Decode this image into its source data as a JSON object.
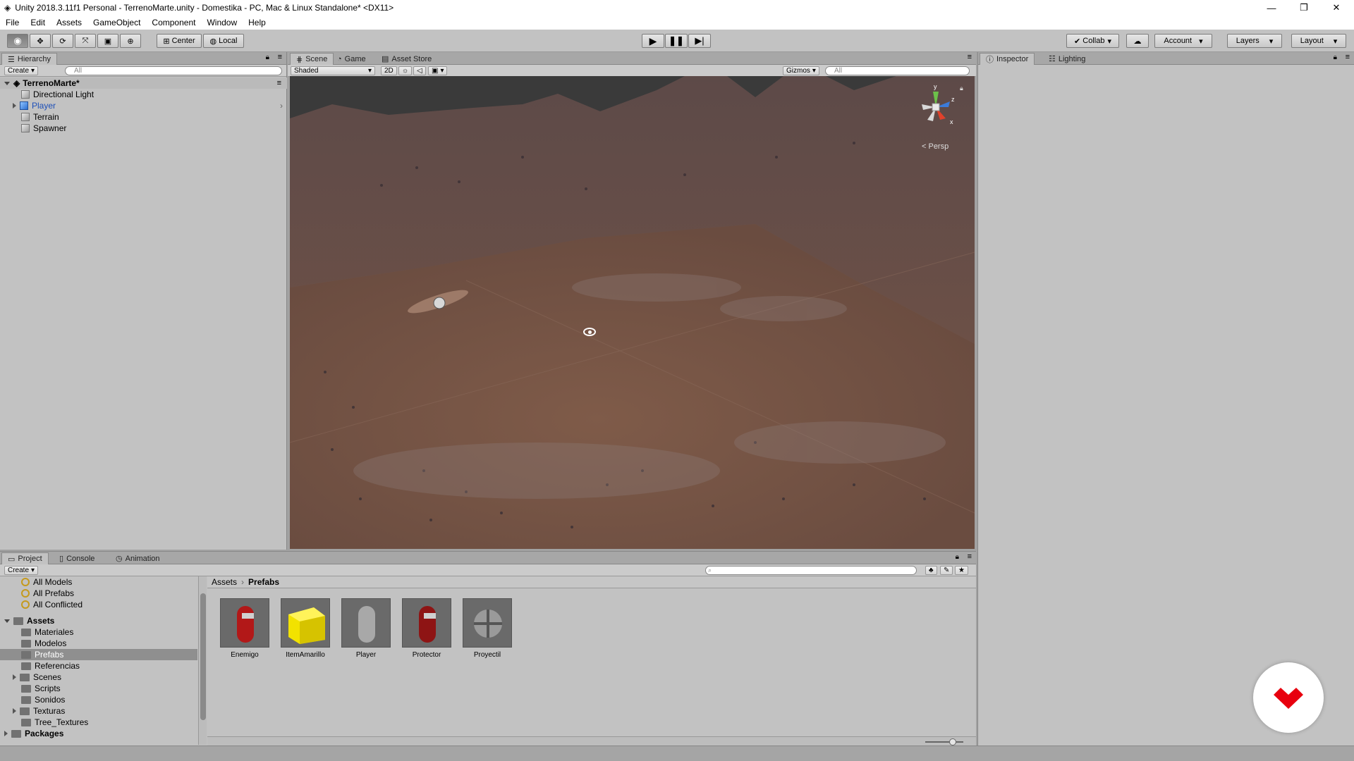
{
  "window": {
    "title": "Unity 2018.3.11f1 Personal - TerrenoMarte.unity - Domestika - PC, Mac & Linux Standalone* <DX11>"
  },
  "menu": [
    "File",
    "Edit",
    "Assets",
    "GameObject",
    "Component",
    "Window",
    "Help"
  ],
  "toolbar": {
    "pivot": "Center",
    "space": "Local",
    "collab": "Collab",
    "account": "Account",
    "layers": "Layers",
    "layout": "Layout"
  },
  "hierarchy": {
    "tab": "Hierarchy",
    "create": "Create",
    "search_placeholder": "All",
    "scene": "TerrenoMarte*",
    "items": [
      "Directional Light",
      "Player",
      "Terrain",
      "Spawner"
    ]
  },
  "scene_tabs": [
    "Scene",
    "Game",
    "Asset Store"
  ],
  "scene_toolbar": {
    "shading": "Shaded",
    "mode_2d": "2D",
    "gizmos": "Gizmos",
    "search_placeholder": "All",
    "persp": "< Persp",
    "axis_y": "y",
    "axis_z": "z",
    "axis_x": "x"
  },
  "inspector": {
    "tab": "Inspector",
    "lighting_tab": "Lighting"
  },
  "bottom_tabs": [
    "Project",
    "Console",
    "Animation"
  ],
  "project": {
    "create": "Create",
    "favorites": [
      "All Models",
      "All Prefabs",
      "All Conflicted"
    ],
    "assets_root": "Assets",
    "folders": [
      "Materiales",
      "Modelos",
      "Prefabs",
      "Referencias",
      "Scenes",
      "Scripts",
      "Sonidos",
      "Texturas",
      "Tree_Textures"
    ],
    "packages": "Packages",
    "breadcrumb": [
      "Assets",
      "Prefabs"
    ],
    "prefabs": [
      "Enemigo",
      "ItemAmarillo",
      "Player",
      "Protector",
      "Proyectil"
    ]
  },
  "colors": {
    "accent_blue": "#2b6fd1",
    "brand": "#e8000e"
  }
}
